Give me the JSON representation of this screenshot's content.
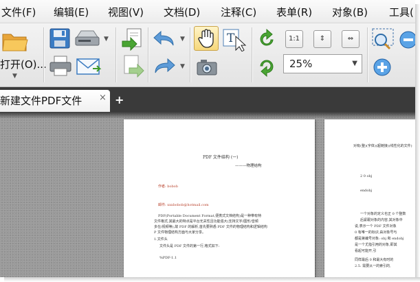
{
  "menubar": {
    "items": [
      {
        "label": "文件(F)"
      },
      {
        "label": "编辑(E)"
      },
      {
        "label": "视图(V)"
      },
      {
        "label": "文档(D)"
      },
      {
        "label": "注释(C)"
      },
      {
        "label": "表单(R)"
      },
      {
        "label": "对象(B)"
      },
      {
        "label": "工具("
      }
    ]
  },
  "toolbar": {
    "open_label": "打开(O)...",
    "zoom_value": "25%",
    "actual_size_label": "1:1"
  },
  "tabs": {
    "active_label": "新建文件PDF文件",
    "close_glyph": "×",
    "new_tab_glyph": "+"
  },
  "colors": {
    "menubar_bg": "#ececec",
    "tabbar_bg": "#3a3a3a",
    "workspace_bg": "#9a9a9a",
    "accent_green": "#3f9a2a",
    "accent_blue": "#2f7ec7"
  },
  "document": {
    "page1": {
      "title": "PDF 文件结构 (一)",
      "subtitle": "———物理结构",
      "author": "作者: bobob",
      "email": "邮件: xxxbobob@hotmail.com",
      "lines": [
        "PDF(Portable   Document   Format,便携式文档结构)是一种带有特",
        "文件格式,其最大的特点是平台无关性且功能强大(支持文字/图形/音频",
        "多在/视频等),故 PDF 的解析,首先要熟悉 PDF 文件的物理结构和逻辑结构",
        "P 文件物理结构方面与大家分享。",
        "1.文件头",
        "文件头是 PDF 文件的第一行,格式如下:",
        "%PDF-1.1"
      ]
    },
    "page2": {
      "lines": [
        "对有(整)(字体)(超链接)(线性化的文件)",
        "2 0 obj",
        "endobj",
        "一个对象的定义也正 0 个整数",
        "后紧跟对象的内容,其对象中",
        "说,表示一个 PDF 文件对象",
        "0 有唯一的标识,由对象号与",
        "都是第编号对象: obj 和 endobj",
        "是一个尤指引用的对象,即其",
        "看起可能开,引",
        "同样最后 0 和最大有时的",
        "2.5. 需要从一的索引的,"
      ]
    }
  }
}
